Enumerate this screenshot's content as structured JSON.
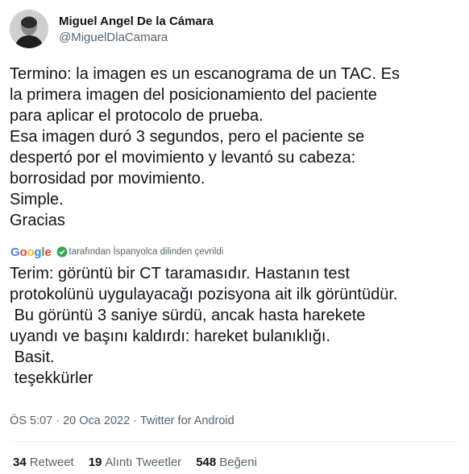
{
  "author": {
    "display_name": "Miguel Angel De la Cámara",
    "handle": "@MiguelDlaCamara"
  },
  "tweet": {
    "original_text": "Termino: la imagen es un escanograma de un TAC. Es\nla primera imagen del posicionamiento del paciente\npara aplicar el protocolo de prueba.\nEsa imagen duró 3 segundos, pero el paciente se\ndespertó por el movimiento y levantó su cabeza:\nborrosidad por movimiento.\nSimple.\nGracias",
    "translation_attribution": "tarafından İspanyolca dilinden çevrildi",
    "translated_text": "Terim: görüntü bir CT taramasıdır. Hastanın test\nprotokolünü uygulayacağı pozisyona ait ilk görüntüdür.\n Bu görüntü 3 saniye sürdü, ancak hasta harekete\nuyandı ve başını kaldırdı: hareket bulanıklığı.\n Basit.\n teşekkürler"
  },
  "meta": {
    "time": "ÖS 5:07",
    "separator": "·",
    "date": "20 Oca 2022",
    "source": "Twitter for Android"
  },
  "stats": [
    {
      "count": "34",
      "label": "Retweet"
    },
    {
      "count": "19",
      "label": "Alıntı Tweetler"
    },
    {
      "count": "548",
      "label": "Beğeni"
    }
  ]
}
